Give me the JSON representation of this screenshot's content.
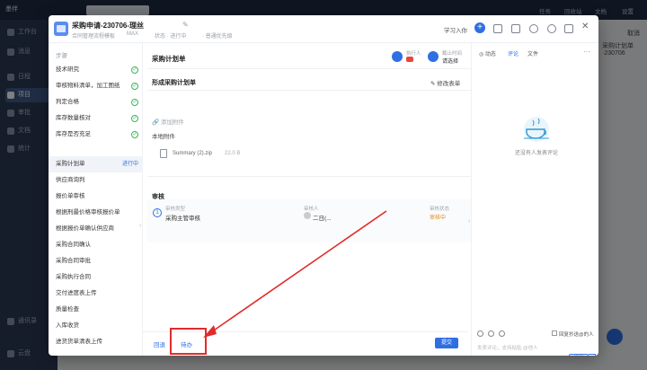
{
  "background": {
    "logo": "墨伴",
    "top_right": [
      "任务",
      "回收站",
      "文档",
      "设置"
    ],
    "sidebar_items": [
      "工作台",
      "消息",
      "日程",
      "项目",
      "审批",
      "文档",
      "统计"
    ],
    "sidebar_bottom": [
      "通讯录",
      "云盘"
    ],
    "right_panel_title": "采购计划单 ·230706",
    "right_panel_btn": "取消"
  },
  "modal": {
    "title": "采购申请-230706-理丝",
    "title_edit_icon": "pencil-icon",
    "subtitle": "合同管理流程模板",
    "subtitle_code": "MAX",
    "status": "状态 · 进行中",
    "priority": "· 普通优先级",
    "import_label": "学习入你",
    "close_icon": "close-icon"
  },
  "steps": {
    "title": "步骤",
    "items": [
      {
        "label": "技术研究",
        "state": "done"
      },
      {
        "label": "审核物料清单，加工图纸",
        "state": "done"
      },
      {
        "label": "判定合格",
        "state": "done"
      },
      {
        "label": "库存数量核对",
        "state": "done"
      },
      {
        "label": "库存是否充足",
        "state": "done"
      },
      {
        "label": "采购计划单",
        "state": "active",
        "state_label": "进行中"
      },
      {
        "label": "供应商询判",
        "state": "pending"
      },
      {
        "label": "报价单审核",
        "state": "pending"
      },
      {
        "label": "根据刑最价格审核报价单",
        "state": "pending"
      },
      {
        "label": "根据报价单确认供应商",
        "state": "pending"
      },
      {
        "label": "采购合同确认",
        "state": "pending"
      },
      {
        "label": "采购合同审批",
        "state": "pending"
      },
      {
        "label": "采购执行合同",
        "state": "pending"
      },
      {
        "label": "交付进度表上传",
        "state": "pending"
      },
      {
        "label": "质量检查",
        "state": "pending"
      },
      {
        "label": "入库收货",
        "state": "pending"
      },
      {
        "label": "进货货单清表上传",
        "state": "pending"
      }
    ]
  },
  "center": {
    "title": "采购计划单",
    "executor_label": "执行人",
    "deadline_label": "截止时间",
    "deadline_value": "请选择",
    "section_title": "形成采购计划单",
    "modify_label": "修改表单",
    "add_attachment": "添加附件",
    "attachment_label": "本地附件",
    "file_name": "Summary (2).zip",
    "file_size": "22.0 B",
    "review_title": "审核",
    "review_number": "1",
    "review_type_label": "审核类型",
    "review_type_value": "采购主管审核",
    "reviewer_label": "审核人",
    "reviewer_value": "二日(...",
    "review_status_label": "审核状态",
    "review_status_value": "审核中"
  },
  "footer": {
    "back_label": "回退",
    "todo_label": "待办",
    "submit_label": "提交"
  },
  "right": {
    "tabs": [
      "动态",
      "评论",
      "文件"
    ],
    "active_tab": 1,
    "empty_text": "还没有人发表评论",
    "notify_label": "回复抄送@的人",
    "input_placeholder": "发表评论，支持粘贴 @他人",
    "send_label": "发送"
  }
}
